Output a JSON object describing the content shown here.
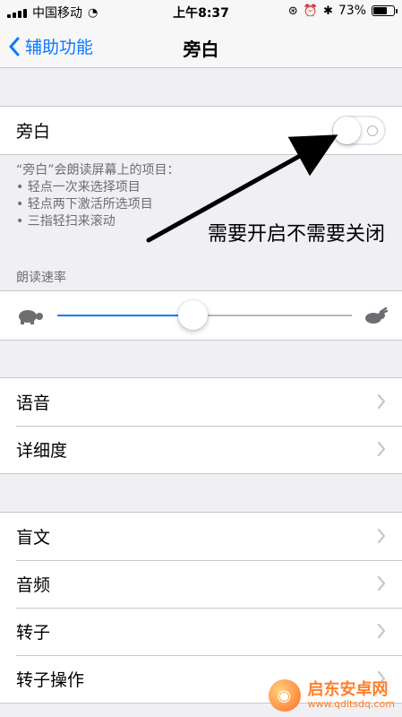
{
  "status_bar": {
    "carrier": "中国移动",
    "time": "上午8:37",
    "battery_percent": "73%",
    "battery_level": 0.73
  },
  "nav": {
    "back_label": "辅助功能",
    "title": "旁白"
  },
  "voiceover": {
    "toggle_label": "旁白",
    "toggle_state": "off",
    "description_title": "“旁白”会朗读屏幕上的项目：",
    "tips": [
      "• 轻点一次来选择项目",
      "• 轻点两下激活所选项目",
      "• 三指轻扫来滚动"
    ]
  },
  "speech_rate": {
    "header": "朗读速率",
    "value": 0.46
  },
  "group2": {
    "items": [
      "语音",
      "详细度"
    ]
  },
  "group3": {
    "items": [
      "盲文",
      "音频",
      "转子",
      "转子操作"
    ]
  },
  "annotation": {
    "text": "需要开启不需要关闭"
  },
  "watermark": {
    "title": "启东安卓网",
    "url": "www.qdltsdq.com"
  },
  "colors": {
    "accent": "#0a7aff",
    "background": "#efeff4",
    "separator": "#c8c7cc"
  }
}
